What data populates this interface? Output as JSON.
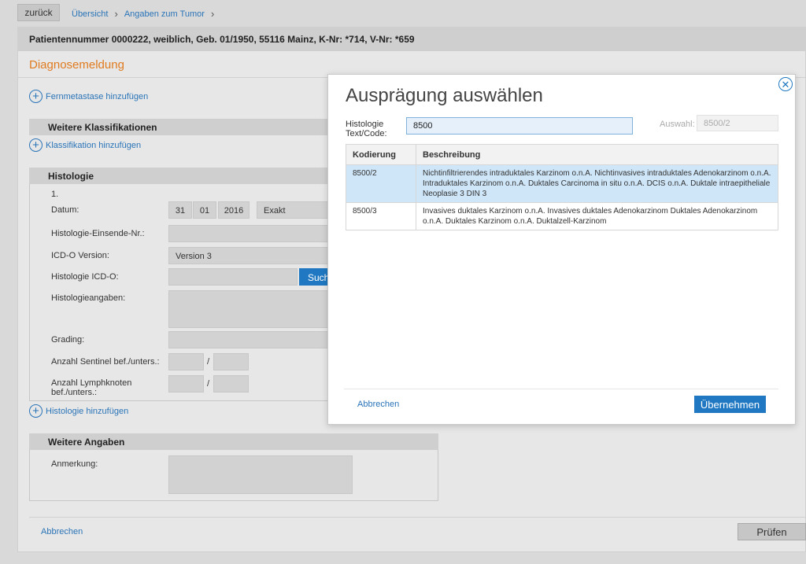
{
  "nav": {
    "back_label": "zurück",
    "breadcrumbs": [
      "Übersicht",
      "Angaben zum Tumor"
    ]
  },
  "patient_bar": "Patientennummer 0000222, weiblich, Geb. 01/1950, 55116 Mainz, K-Nr: *714, V-Nr: *659",
  "page_title": "Diagnosemeldung",
  "links": {
    "fernmetastase": "Fernmetastase hinzufügen",
    "klassifikation": "Klassifikation hinzufügen",
    "histologie_add": "Histologie hinzufügen"
  },
  "sections": {
    "weitere_klassifikationen": "Weitere Klassifikationen",
    "histologie": "Histologie",
    "weitere_angaben": "Weitere Angaben"
  },
  "histologie_form": {
    "index": "1.",
    "datum_label": "Datum:",
    "datum_day": "31",
    "datum_month": "01",
    "datum_year": "2016",
    "datum_precision": "Exakt",
    "einsende_label": "Histologie-Einsende-Nr.:",
    "icdo_version_label": "ICD-O Version:",
    "icdo_version_value": "Version 3",
    "icdo_label": "Histologie ICD-O:",
    "search_button": "Such",
    "angaben_label": "Histologieangaben:",
    "grading_label": "Grading:",
    "sentinel_label": "Anzahl Sentinel bef./unters.:",
    "lymph_label_line1": "Anzahl Lymphknoten",
    "lymph_label_line2": "bef./unters.:",
    "slash": "/"
  },
  "weitere_angaben": {
    "anmerkung_label": "Anmerkung:"
  },
  "footer": {
    "cancel": "Abbrechen",
    "check": "Prüfen"
  },
  "modal": {
    "title": "Ausprägung auswählen",
    "search_label_line1": "Histologie",
    "search_label_line2": "Text/Code:",
    "search_value": "8500",
    "auswahl_label": "Auswahl:",
    "auswahl_value": "8500/2",
    "columns": [
      "Kodierung",
      "Beschreibung"
    ],
    "rows": [
      {
        "code": "8500/2",
        "desc": "Nichtinfiltrierendes intraduktales Karzinom o.n.A. Nichtinvasives intraduktales Adenokarzinom o.n.A. Intraduktales Karzinom o.n.A. Duktales Carcinoma in situ o.n.A. DCIS o.n.A. Duktale intraepitheliale Neoplasie 3 DIN 3",
        "selected": true
      },
      {
        "code": "8500/3",
        "desc": "Invasives duktales Karzinom o.n.A. Invasives duktales Adenokarzinom Duktales Adenokarzinom o.n.A. Duktales Karzinom o.n.A. Duktalzell-Karzinom",
        "selected": false
      }
    ],
    "cancel": "Abbrechen",
    "apply": "Übernehmen"
  },
  "colors": {
    "accent_blue": "#1f78c1",
    "title_orange": "#e07b1f",
    "selected_row": "#cfe6f8"
  },
  "icons": [
    "plus-circle-icon",
    "chevron-right-icon",
    "close-circle-icon"
  ]
}
